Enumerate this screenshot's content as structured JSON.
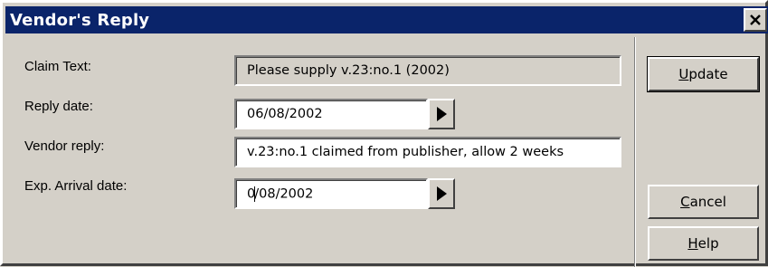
{
  "window": {
    "title": "Vendor's Reply",
    "close_icon": "close-icon"
  },
  "form": {
    "claim_text": {
      "label": "Claim Text:",
      "value": "Please supply v.23:no.1 (2002)"
    },
    "reply_date": {
      "label": "Reply date:",
      "value": "06/08/2002",
      "button_icon": "play-arrow-icon"
    },
    "vendor_reply": {
      "label": "Vendor reply:",
      "value": "v.23:no.1 claimed from publisher, allow 2 weeks"
    },
    "arrival_date": {
      "label": "Exp. Arrival date:",
      "value_before_caret": "0",
      "value_after_caret": "/08/2002",
      "button_icon": "play-arrow-icon"
    }
  },
  "buttons": {
    "update": {
      "mnemonic": "U",
      "rest": "pdate"
    },
    "cancel": {
      "mnemonic": "C",
      "rest": "ancel"
    },
    "help": {
      "mnemonic": "H",
      "rest": "elp"
    }
  },
  "colors": {
    "titlebar": "#0a246a",
    "face": "#d4d0c8",
    "field_bg": "#ffffff"
  }
}
